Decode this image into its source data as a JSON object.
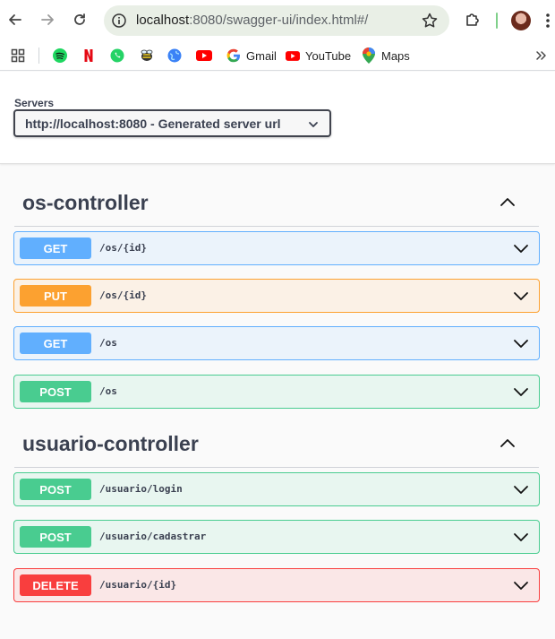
{
  "browser": {
    "url_host": "localhost",
    "url_rest": ":8080/swagger-ui/index.html#/",
    "bookmarks": [
      {
        "label": "",
        "icon": "apps-grid-icon"
      },
      {
        "label": "",
        "icon": "spotify-icon"
      },
      {
        "label": "",
        "icon": "netflix-icon"
      },
      {
        "label": "",
        "icon": "whatsapp-icon"
      },
      {
        "label": "",
        "icon": "bee-icon"
      },
      {
        "label": "",
        "icon": "globe-icon"
      },
      {
        "label": "",
        "icon": "youtube-icon"
      },
      {
        "label": "Gmail",
        "icon": "google-icon"
      },
      {
        "label": "YouTube",
        "icon": "youtube-icon"
      },
      {
        "label": "Maps",
        "icon": "maps-pin-icon"
      }
    ]
  },
  "servers": {
    "label": "Servers",
    "selected": "http://localhost:8080 - Generated server url"
  },
  "sections": [
    {
      "title": "os-controller",
      "operations": [
        {
          "method": "GET",
          "path": "/os/{id}"
        },
        {
          "method": "PUT",
          "path": "/os/{id}"
        },
        {
          "method": "GET",
          "path": "/os"
        },
        {
          "method": "POST",
          "path": "/os"
        }
      ]
    },
    {
      "title": "usuario-controller",
      "operations": [
        {
          "method": "POST",
          "path": "/usuario/login"
        },
        {
          "method": "POST",
          "path": "/usuario/cadastrar"
        },
        {
          "method": "DELETE",
          "path": "/usuario/{id}"
        }
      ]
    }
  ],
  "colors": {
    "get": "#61affe",
    "put": "#fca130",
    "post": "#49cc90",
    "delete": "#f93e3e",
    "text": "#3b4151"
  }
}
